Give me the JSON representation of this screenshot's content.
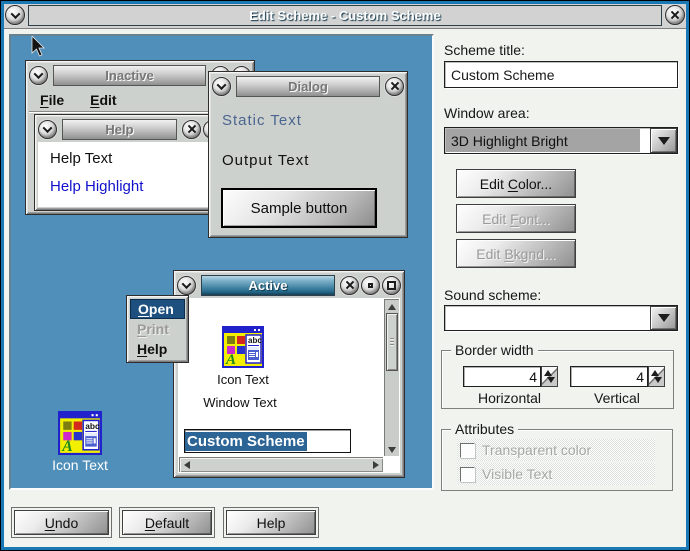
{
  "window": {
    "title": "Edit Scheme - Custom Scheme"
  },
  "preview": {
    "inactive": {
      "title": "Inactive",
      "menu_file": {
        "key": "F",
        "post": "ile"
      },
      "menu_edit": {
        "key": "E",
        "post": "dit"
      }
    },
    "help_win": {
      "title": "Help",
      "line1": "Help Text",
      "line2": "Help Highlight"
    },
    "dialog": {
      "title": "Dialog",
      "static_text": "Static Text",
      "output_text": "Output Text",
      "sample_button": "Sample button"
    },
    "active": {
      "title": "Active",
      "icon_text": "Icon Text",
      "window_text": "Window Text",
      "input_value": "Custom Scheme"
    },
    "popup": {
      "open": {
        "key": "O",
        "post": "pen"
      },
      "print": {
        "key": "P",
        "post": "rint"
      },
      "help": {
        "key": "H",
        "post": "elp"
      }
    },
    "desktop_icon_label": "Icon Text"
  },
  "panel": {
    "scheme_title_label": "Scheme title:",
    "scheme_title_value": "Custom Scheme",
    "window_area_label": "Window area:",
    "window_area_value": "3D Highlight Bright",
    "edit_color": {
      "pre": "Edit ",
      "key": "C",
      "post": "olor..."
    },
    "edit_font": {
      "pre": "Edit ",
      "key": "F",
      "post": "ont..."
    },
    "edit_bkgnd": {
      "pre": "Edit ",
      "key": "B",
      "post": "kgnd..."
    },
    "sound_scheme_label": "Sound scheme:",
    "sound_scheme_value": "",
    "border_width": {
      "legend": "Border width",
      "horizontal_value": "4",
      "vertical_value": "4",
      "horizontal_label": "Horizontal",
      "vertical_label": "Vertical"
    },
    "attributes": {
      "legend": "Attributes",
      "item1": "Transparent color",
      "item2": "Visible Text"
    }
  },
  "footer": {
    "undo": {
      "key": "U",
      "post": "ndo"
    },
    "default": {
      "key": "D",
      "post": "efault"
    },
    "help": "Help"
  },
  "icons": {
    "app_icon_letter": "A",
    "app_icon_abc": "abc"
  },
  "colors": {
    "frame_teal": "#1a78b4",
    "preview_blue": "#4f8fba",
    "titlebar_gradient_top": "#b7d6e3",
    "titlebar_gradient_bottom": "#143f55",
    "selection_blue": "#2d6496",
    "menu_select_blue": "#1d4f7f",
    "help_highlight_blue": "#1111cc",
    "static_text_blue": "#4a6590",
    "dialog_gray": "#cdd1cd",
    "panel_bg": "#f1f3ef",
    "icon_yellow": "#f2ef00"
  }
}
